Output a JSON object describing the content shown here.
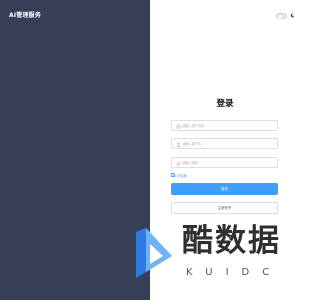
{
  "brand": {
    "title": "AI管理服务"
  },
  "theme_toggle": {
    "icon": "moon-icon",
    "state": "off"
  },
  "login": {
    "title": "登录",
    "fields": [
      {
        "placeholder": "请输入用户名称",
        "icon": "user-circle-icon"
      },
      {
        "placeholder": "请输入用户名",
        "icon": "user-icon"
      },
      {
        "placeholder": "请输入密码",
        "icon": "lock-icon"
      }
    ],
    "remember_label": "记住我",
    "remember_checked": true,
    "submit_label": "登录",
    "secondary_label": "注册账号"
  },
  "watermark": {
    "title": "酷数据",
    "subtitle": "KUIDC"
  },
  "colors": {
    "sidebar_bg": "#363f56",
    "primary": "#409eff",
    "border": "#dcdfe6",
    "watermark_blue": "#2e7be8"
  }
}
